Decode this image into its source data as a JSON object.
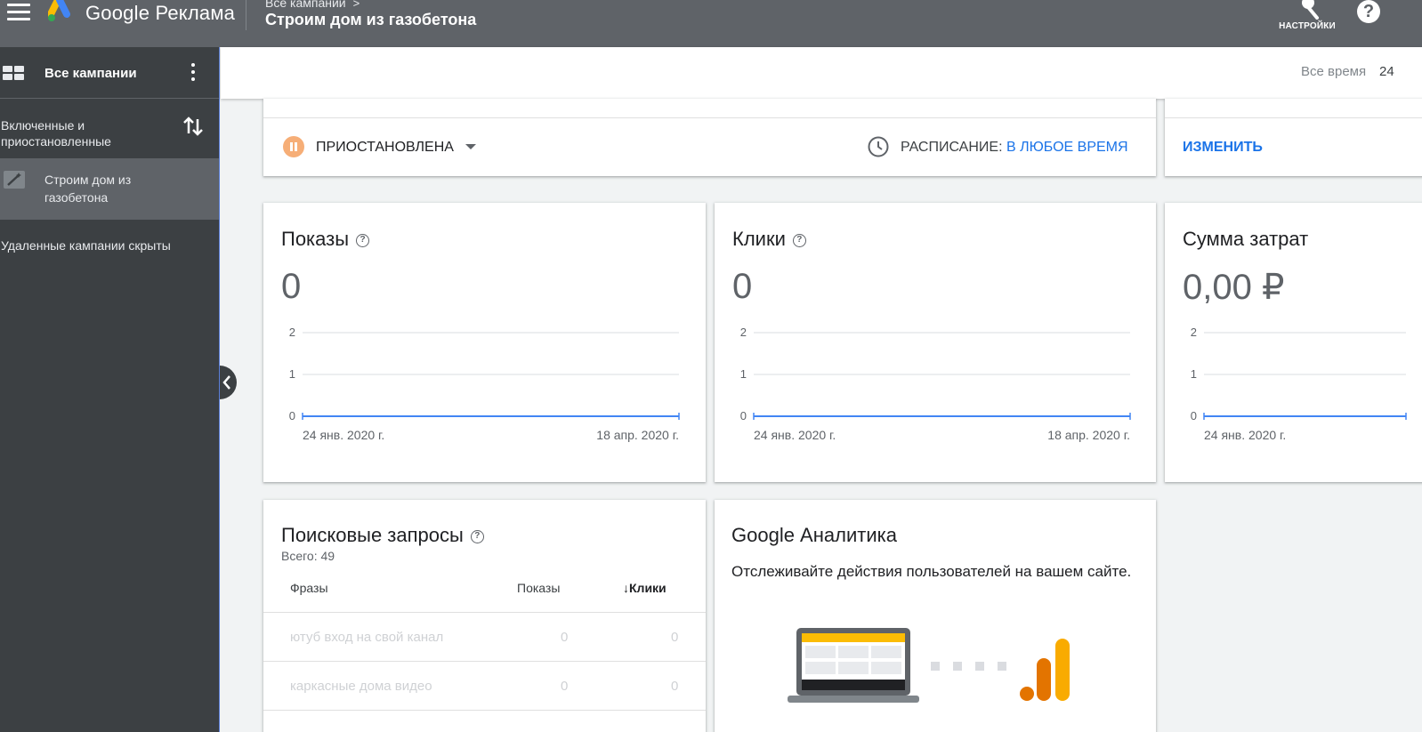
{
  "header": {
    "app_name": "Google Реклама",
    "breadcrumb": "Все кампании",
    "breadcrumb_chevron": ">",
    "campaign_title": "Строим дом из газобетона",
    "tools_label": "НАСТРОЙКИ",
    "help_symbol": "?"
  },
  "sidebar": {
    "all_campaigns": "Все кампании",
    "filter_label": "Включенные и приостановленные",
    "campaign": "Строим дом из газобетона",
    "deleted_note": "Удаленные кампании скрыты"
  },
  "filterbar": {
    "range_label": "Все время",
    "range_value": "24"
  },
  "status": {
    "state": "ПРИОСТАНОВЛЕНА",
    "schedule_label": "РАСПИСАНИЕ:",
    "schedule_value": "В ЛЮБОЕ ВРЕМЯ",
    "edit": "ИЗМЕНИТЬ"
  },
  "metrics": [
    {
      "title": "Показы",
      "has_help": true,
      "value": "0"
    },
    {
      "title": "Клики",
      "has_help": true,
      "value": "0"
    },
    {
      "title": "Сумма затрат",
      "has_help": false,
      "value": "0,00 ₽"
    }
  ],
  "chart_data": [
    {
      "type": "line",
      "title": "Показы",
      "y_ticks": [
        "2",
        "1",
        "0"
      ],
      "ylim": [
        0,
        2
      ],
      "x_start": "24 янв. 2020 г.",
      "x_end": "18 апр. 2020 г.",
      "series": [
        {
          "values": [
            0,
            0
          ]
        }
      ],
      "color": "#4285f4"
    },
    {
      "type": "line",
      "title": "Клики",
      "y_ticks": [
        "2",
        "1",
        "0"
      ],
      "ylim": [
        0,
        2
      ],
      "x_start": "24 янв. 2020 г.",
      "x_end": "18 апр. 2020 г.",
      "series": [
        {
          "values": [
            0,
            0
          ]
        }
      ],
      "color": "#4285f4"
    },
    {
      "type": "line",
      "title": "Сумма затрат",
      "y_ticks": [
        "2",
        "1",
        "0"
      ],
      "ylim": [
        0,
        2
      ],
      "x_start": "24 янв. 2020 г.",
      "x_end": "",
      "series": [
        {
          "values": [
            0,
            0
          ]
        }
      ],
      "color": "#4285f4"
    }
  ],
  "search_queries": {
    "title": "Поисковые запросы",
    "total": "Всего: 49",
    "columns": [
      "Фразы",
      "Показы",
      "Клики"
    ],
    "sort_arrow": "↓",
    "rows": [
      {
        "phrase": "ютуб вход на свой канал",
        "impressions": "0",
        "clicks": "0"
      },
      {
        "phrase": "каркасные дома видео",
        "impressions": "0",
        "clicks": "0"
      }
    ]
  },
  "analytics": {
    "title": "Google Аналитика",
    "description": "Отслеживайте действия пользователей на вашем сайте."
  },
  "colors": {
    "topbar": "#5f6368",
    "sidebar": "#3c4043",
    "accent_blue": "#1a73e8",
    "paused_orange": "#f6ae77",
    "chart_line": "#4285f4"
  },
  "icons": [
    "menu-icon",
    "google-ads-logo",
    "wrench-icon",
    "help-icon",
    "grid-icon",
    "more-vert-icon",
    "sort-icon",
    "campaign-wand-icon",
    "chevron-left-icon",
    "pause-icon",
    "dropdown-arrow-icon",
    "clock-icon",
    "question-circle-icon",
    "arrow-down-icon"
  ]
}
